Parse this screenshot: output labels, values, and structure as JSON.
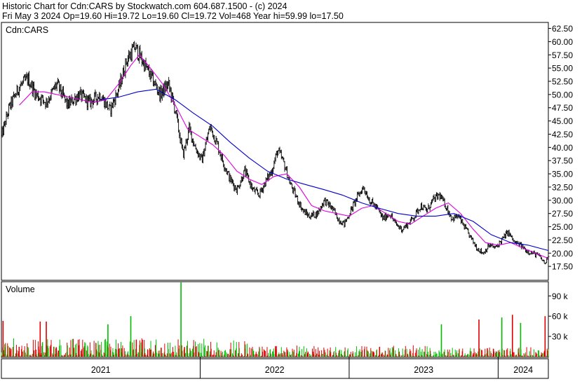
{
  "header": {
    "line1": "Historic Chart for Cdn:CARS by Stockwatch.com 604.687.1500 - (c) 2024",
    "line2": "Fri May  3 2024  Op=19.60  Hi=19.72  Lo=19.60  Cl=19.72  Vol=468  Year hi=59.99  lo=17.50"
  },
  "chart_data": [
    {
      "type": "line",
      "title": "Cdn:CARS",
      "ylim": [
        15.0,
        63.5
      ],
      "yticks": [
        "62.50",
        "60.00",
        "57.50",
        "55.00",
        "52.50",
        "50.00",
        "47.50",
        "45.00",
        "42.50",
        "40.00",
        "37.50",
        "35.00",
        "32.50",
        "30.00",
        "27.50",
        "25.00",
        "22.50",
        "20.00",
        "17.50"
      ],
      "x_range": [
        "2020-09-01",
        "2024-05-03"
      ],
      "x_labels": [
        "2021",
        "2022",
        "2023",
        "2024"
      ],
      "grid": false,
      "series": [
        {
          "style": "price-bars",
          "color": "#000000",
          "points": [
            [
              "2020-09-01",
              42.0
            ],
            [
              "2020-09-20",
              47.5
            ],
            [
              "2020-10-15",
              51.5
            ],
            [
              "2020-11-05",
              53.0
            ],
            [
              "2020-11-25",
              50.0
            ],
            [
              "2020-12-20",
              48.5
            ],
            [
              "2021-01-15",
              52.0
            ],
            [
              "2021-02-10",
              48.0
            ],
            [
              "2021-03-10",
              50.0
            ],
            [
              "2021-04-05",
              48.5
            ],
            [
              "2021-05-01",
              50.0
            ],
            [
              "2021-05-25",
              47.0
            ],
            [
              "2021-06-15",
              51.0
            ],
            [
              "2021-07-05",
              56.5
            ],
            [
              "2021-07-25",
              59.0
            ],
            [
              "2021-08-15",
              56.0
            ],
            [
              "2021-09-05",
              53.0
            ],
            [
              "2021-09-25",
              50.0
            ],
            [
              "2021-10-15",
              52.0
            ],
            [
              "2021-11-01",
              47.0
            ],
            [
              "2021-11-20",
              38.5
            ],
            [
              "2021-12-05",
              43.5
            ],
            [
              "2021-12-20",
              40.0
            ],
            [
              "2022-01-05",
              37.5
            ],
            [
              "2022-01-25",
              44.0
            ],
            [
              "2022-02-10",
              41.0
            ],
            [
              "2022-02-25",
              37.5
            ],
            [
              "2022-03-15",
              34.0
            ],
            [
              "2022-04-01",
              32.0
            ],
            [
              "2022-04-20",
              35.5
            ],
            [
              "2022-05-10",
              32.0
            ],
            [
              "2022-05-25",
              31.0
            ],
            [
              "2022-06-10",
              33.5
            ],
            [
              "2022-06-25",
              35.5
            ],
            [
              "2022-07-10",
              39.5
            ],
            [
              "2022-07-25",
              37.0
            ],
            [
              "2022-08-10",
              33.0
            ],
            [
              "2022-08-25",
              30.5
            ],
            [
              "2022-09-10",
              28.0
            ],
            [
              "2022-09-25",
              27.0
            ],
            [
              "2022-10-15",
              27.5
            ],
            [
              "2022-11-01",
              30.0
            ],
            [
              "2022-11-20",
              28.5
            ],
            [
              "2022-12-05",
              26.5
            ],
            [
              "2022-12-20",
              25.5
            ],
            [
              "2023-01-05",
              28.0
            ],
            [
              "2023-01-20",
              30.5
            ],
            [
              "2023-02-05",
              32.5
            ],
            [
              "2023-02-20",
              30.0
            ],
            [
              "2023-03-10",
              28.5
            ],
            [
              "2023-03-25",
              26.5
            ],
            [
              "2023-04-10",
              27.5
            ],
            [
              "2023-04-25",
              25.5
            ],
            [
              "2023-05-10",
              24.5
            ],
            [
              "2023-05-25",
              25.5
            ],
            [
              "2023-06-10",
              27.0
            ],
            [
              "2023-06-25",
              29.0
            ],
            [
              "2023-07-10",
              28.0
            ],
            [
              "2023-07-25",
              30.0
            ],
            [
              "2023-08-10",
              31.0
            ],
            [
              "2023-08-25",
              29.0
            ],
            [
              "2023-09-10",
              26.5
            ],
            [
              "2023-09-25",
              27.0
            ],
            [
              "2023-10-10",
              25.0
            ],
            [
              "2023-10-25",
              23.0
            ],
            [
              "2023-11-10",
              21.0
            ],
            [
              "2023-11-25",
              20.0
            ],
            [
              "2023-12-10",
              21.5
            ],
            [
              "2023-12-25",
              21.0
            ],
            [
              "2024-01-10",
              22.5
            ],
            [
              "2024-01-25",
              24.0
            ],
            [
              "2024-02-10",
              22.0
            ],
            [
              "2024-02-25",
              21.5
            ],
            [
              "2024-03-10",
              20.5
            ],
            [
              "2024-03-25",
              20.0
            ],
            [
              "2024-04-10",
              19.5
            ],
            [
              "2024-04-25",
              18.0
            ],
            [
              "2024-05-03",
              19.7
            ]
          ]
        },
        {
          "style": "moving-average-short",
          "color": "#dd00dd",
          "points": [
            [
              "2020-10-15",
              48.0
            ],
            [
              "2020-11-15",
              50.5
            ],
            [
              "2020-12-15",
              50.5
            ],
            [
              "2021-01-15",
              50.0
            ],
            [
              "2021-02-15",
              49.5
            ],
            [
              "2021-03-15",
              49.0
            ],
            [
              "2021-04-15",
              48.5
            ],
            [
              "2021-05-15",
              49.0
            ],
            [
              "2021-06-15",
              52.0
            ],
            [
              "2021-07-15",
              55.5
            ],
            [
              "2021-08-05",
              57.5
            ],
            [
              "2021-09-01",
              55.0
            ],
            [
              "2021-10-01",
              52.0
            ],
            [
              "2021-11-01",
              48.0
            ],
            [
              "2021-12-01",
              43.5
            ],
            [
              "2022-01-01",
              42.0
            ],
            [
              "2022-02-01",
              40.5
            ],
            [
              "2022-03-01",
              38.5
            ],
            [
              "2022-04-01",
              35.5
            ],
            [
              "2022-05-01",
              34.0
            ],
            [
              "2022-06-01",
              33.0
            ],
            [
              "2022-07-01",
              34.5
            ],
            [
              "2022-08-01",
              35.0
            ],
            [
              "2022-09-01",
              32.5
            ],
            [
              "2022-10-01",
              29.0
            ],
            [
              "2022-11-01",
              28.0
            ],
            [
              "2022-12-01",
              27.5
            ],
            [
              "2023-01-01",
              27.0
            ],
            [
              "2023-02-01",
              28.5
            ],
            [
              "2023-03-01",
              29.0
            ],
            [
              "2023-04-01",
              27.5
            ],
            [
              "2023-05-01",
              26.0
            ],
            [
              "2023-06-01",
              25.5
            ],
            [
              "2023-07-01",
              27.0
            ],
            [
              "2023-08-01",
              28.5
            ],
            [
              "2023-09-01",
              29.5
            ],
            [
              "2023-10-01",
              27.5
            ],
            [
              "2023-11-01",
              24.5
            ],
            [
              "2023-12-01",
              22.0
            ],
            [
              "2024-01-01",
              21.5
            ],
            [
              "2024-02-01",
              22.0
            ],
            [
              "2024-03-01",
              21.0
            ],
            [
              "2024-04-01",
              20.0
            ],
            [
              "2024-05-03",
              19.0
            ]
          ]
        },
        {
          "style": "moving-average-long",
          "color": "#0000cc",
          "points": [
            [
              "2021-05-01",
              49.0
            ],
            [
              "2021-06-15",
              49.5
            ],
            [
              "2021-08-01",
              50.5
            ],
            [
              "2021-09-15",
              51.0
            ],
            [
              "2021-11-01",
              49.0
            ],
            [
              "2021-12-15",
              46.5
            ],
            [
              "2022-02-01",
              44.0
            ],
            [
              "2022-03-15",
              41.0
            ],
            [
              "2022-05-01",
              38.0
            ],
            [
              "2022-06-15",
              35.5
            ],
            [
              "2022-08-01",
              34.0
            ],
            [
              "2022-09-15",
              33.0
            ],
            [
              "2022-11-01",
              32.0
            ],
            [
              "2022-12-15",
              31.0
            ],
            [
              "2023-02-01",
              29.5
            ],
            [
              "2023-03-15",
              28.5
            ],
            [
              "2023-05-01",
              27.5
            ],
            [
              "2023-06-15",
              27.0
            ],
            [
              "2023-08-01",
              27.0
            ],
            [
              "2023-09-15",
              27.5
            ],
            [
              "2023-11-01",
              26.0
            ],
            [
              "2023-12-15",
              23.5
            ],
            [
              "2024-02-01",
              22.0
            ],
            [
              "2024-03-15",
              21.5
            ],
            [
              "2024-05-03",
              20.5
            ]
          ]
        }
      ]
    },
    {
      "type": "bar",
      "title": "Volume",
      "ylim": [
        0,
        110000
      ],
      "yticks": [
        "90 k",
        "60 k",
        "30 k"
      ],
      "ytick_values": [
        90000,
        60000,
        30000
      ],
      "colors": {
        "up": "#00bb00",
        "down": "#dd0000"
      },
      "spikes": [
        [
          "2020-09-05",
          53000,
          "down"
        ],
        [
          "2020-12-05",
          52000,
          "down"
        ],
        [
          "2020-12-20",
          52000,
          "down"
        ],
        [
          "2021-05-20",
          48000,
          "up"
        ],
        [
          "2021-07-15",
          60000,
          "up"
        ],
        [
          "2021-11-15",
          110000,
          "up"
        ],
        [
          "2023-08-15",
          48000,
          "up"
        ],
        [
          "2023-11-15",
          55000,
          "down"
        ],
        [
          "2024-01-10",
          58000,
          "up"
        ],
        [
          "2024-02-05",
          62000,
          "down"
        ],
        [
          "2024-02-25",
          50000,
          "up"
        ],
        [
          "2024-04-25",
          60000,
          "down"
        ]
      ]
    }
  ]
}
